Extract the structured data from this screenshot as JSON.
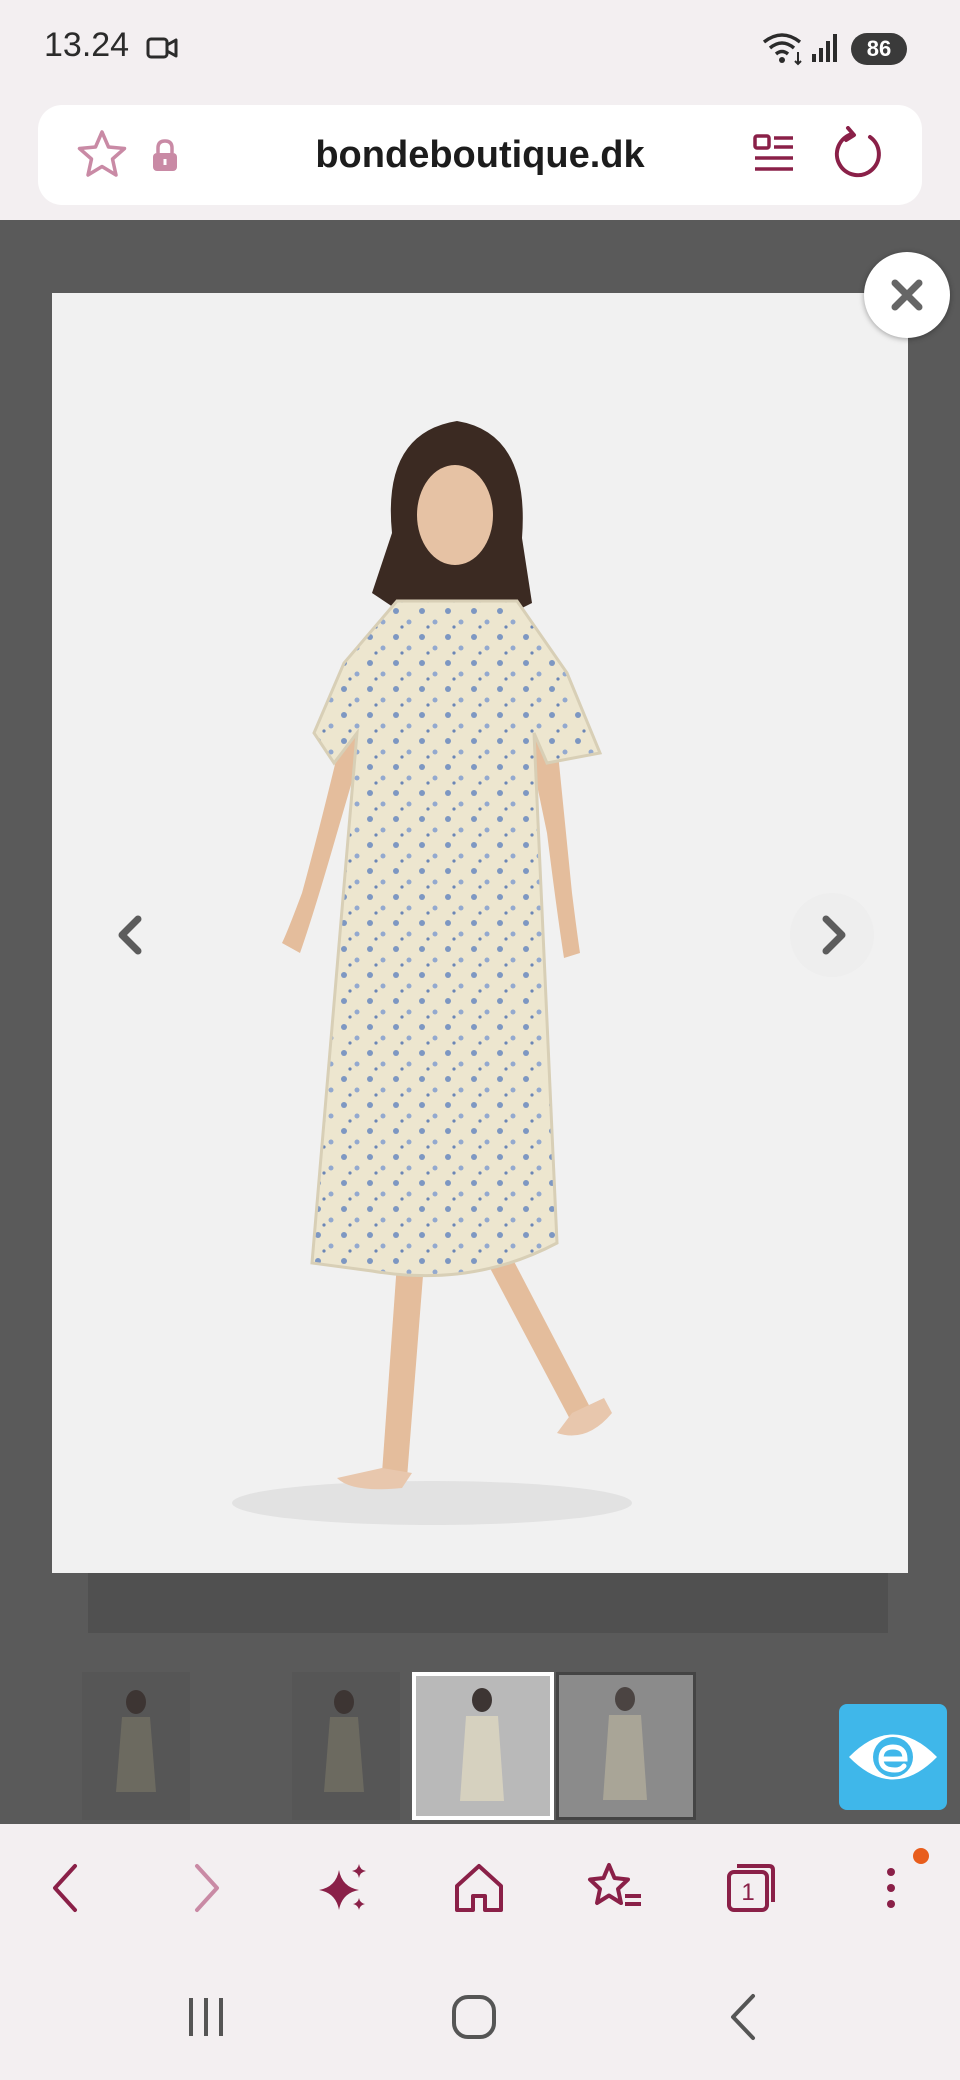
{
  "status_bar": {
    "time": "13.24",
    "battery_level": "86",
    "icons": [
      "video-camera-icon",
      "wifi-icon",
      "signal-icon",
      "battery-icon"
    ]
  },
  "browser": {
    "url": "bondeboutique.dk",
    "address_icons": [
      "bookmark-star-icon",
      "lock-icon",
      "reader-mode-icon",
      "reload-icon"
    ],
    "accent_color": "#8a2048"
  },
  "gallery": {
    "image_count": 4,
    "selected_index": 3,
    "overlay_color": "#5a5a5a",
    "icons": [
      "close-icon",
      "chevron-left-icon",
      "chevron-right-icon"
    ]
  },
  "accessibility": {
    "icon": "accessibility-eye-icon",
    "color": "#3fb7ea"
  },
  "toolbar": {
    "buttons": [
      "back",
      "forward",
      "ai-sparkle",
      "home",
      "bookmarks",
      "tabs",
      "menu"
    ],
    "tab_count": "1",
    "notification_color": "#e85d1c"
  },
  "system_nav": [
    "recent-apps",
    "home",
    "back"
  ]
}
